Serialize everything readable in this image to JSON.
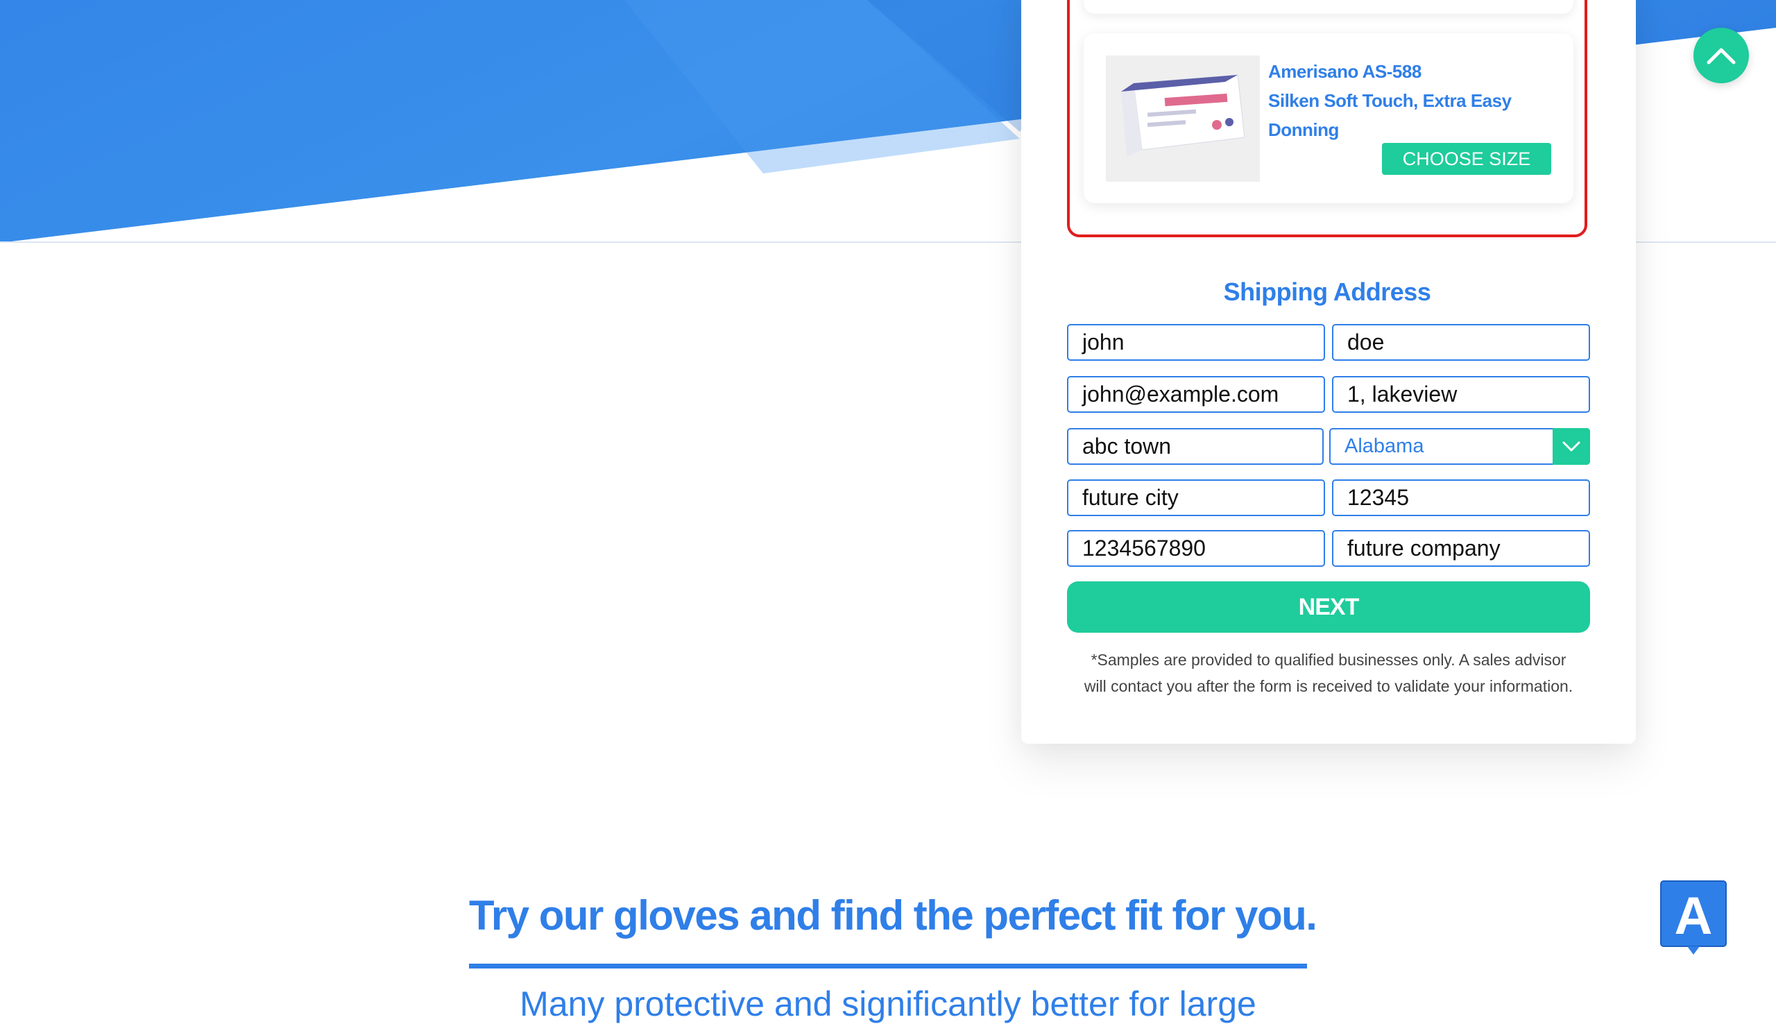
{
  "colors": {
    "brand_blue": "#2f7fe8",
    "accent_green": "#1fcc9b",
    "selection_red": "#e11d1d",
    "hero_blue": "#3a8ae6"
  },
  "product": {
    "name_line1": "Amerisano AS-588",
    "name_line2": "Silken Soft Touch, Extra Easy",
    "name_line3": "Donning",
    "choose_size_label": "CHOOSE SIZE",
    "image_icon": "nitrile-gloves-box"
  },
  "shipping": {
    "title": "Shipping Address",
    "first_name": "john",
    "last_name": "doe",
    "email": "john@example.com",
    "address": "1, lakeview",
    "town": "abc town",
    "state": "Alabama",
    "city": "future city",
    "zip": "12345",
    "phone": "1234567890",
    "company": "future company"
  },
  "next_label": "NEXT",
  "disclaimer_line1": "*Samples are provided to qualified businesses only. A sales advisor",
  "disclaimer_line2": "will contact you after the form is received to validate your information.",
  "scroll_top_icon": "chevron-up-icon",
  "bottom": {
    "heading": "Try our gloves and find the perfect fit for you.",
    "subheading": "Many protective and significantly better for large"
  },
  "accessibility_widget": {
    "label": "A",
    "icon": "accessibility-icon"
  }
}
